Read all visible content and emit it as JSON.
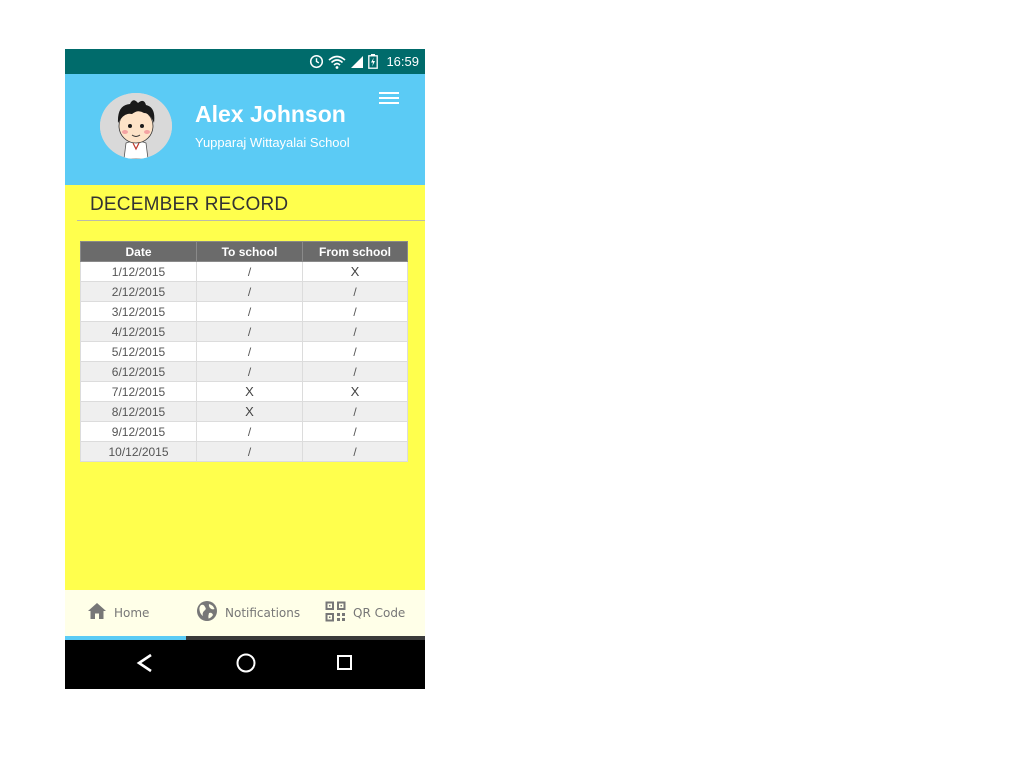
{
  "status_bar": {
    "time": "16:59"
  },
  "profile": {
    "name": "Alex Johnson",
    "school": "Yupparaj Wittayalai School"
  },
  "record": {
    "title": "DECEMBER RECORD",
    "columns": [
      "Date",
      "To school",
      "From school"
    ],
    "rows": [
      [
        "1/12/2015",
        "/",
        "X"
      ],
      [
        "2/12/2015",
        "/",
        "/"
      ],
      [
        "3/12/2015",
        "/",
        "/"
      ],
      [
        "4/12/2015",
        "/",
        "/"
      ],
      [
        "5/12/2015",
        "/",
        "/"
      ],
      [
        "6/12/2015",
        "/",
        "/"
      ],
      [
        "7/12/2015",
        "X",
        "X"
      ],
      [
        "8/12/2015",
        "X",
        "/"
      ],
      [
        "9/12/2015",
        "/",
        "/"
      ],
      [
        "10/12/2015",
        "/",
        "/"
      ]
    ]
  },
  "bottom_nav": [
    {
      "label": "Home",
      "icon": "home-icon",
      "active": true
    },
    {
      "label": "Notifications",
      "icon": "globe-icon",
      "active": false
    },
    {
      "label": "QR Code",
      "icon": "qr-code-icon",
      "active": false
    }
  ],
  "colors": {
    "status_bar": "#006b6b",
    "header": "#5bcbf5",
    "background": "#ffff4d",
    "table_header": "#6b6b6b",
    "active_tab": "#5bcbf5"
  }
}
